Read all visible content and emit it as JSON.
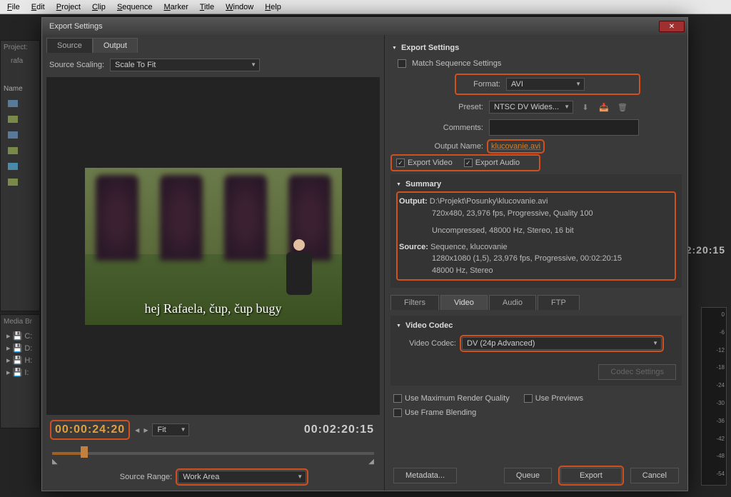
{
  "menubar": [
    "File",
    "Edit",
    "Project",
    "Clip",
    "Sequence",
    "Marker",
    "Title",
    "Window",
    "Help"
  ],
  "bg": {
    "project_label": "Project:",
    "item_label": "rafa",
    "name_col": "Name",
    "mediab": "Media Br",
    "drives": [
      "C:",
      "D:",
      "H:",
      "I:"
    ],
    "side_tc": "2:20:15"
  },
  "dialog": {
    "title": "Export Settings",
    "tabs": {
      "source": "Source",
      "output": "Output"
    },
    "source_scaling_label": "Source Scaling:",
    "source_scaling_value": "Scale To Fit",
    "preview_caption": "hej Rafaela, čup, čup bugy",
    "tc_in": "00:00:24:20",
    "tc_out": "00:02:20:15",
    "fit_label": "Fit",
    "source_range_label": "Source Range:",
    "source_range_value": "Work Area"
  },
  "export": {
    "header": "Export Settings",
    "match_seq": "Match Sequence Settings",
    "format_label": "Format:",
    "format_value": "AVI",
    "preset_label": "Preset:",
    "preset_value": "NTSC DV Wides...",
    "comments_label": "Comments:",
    "output_name_label": "Output Name:",
    "output_name_value": "klucovanie.avi",
    "export_video": "Export Video",
    "export_audio": "Export Audio"
  },
  "summary": {
    "header": "Summary",
    "output_label": "Output:",
    "output_path": "D:\\Projekt\\Posunky\\klucovanie.avi",
    "output_spec": "720x480, 23,976 fps, Progressive, Quality 100",
    "output_audio": "Uncompressed, 48000 Hz, Stereo, 16 bit",
    "source_label": "Source:",
    "source_seq": "Sequence, klucovanie",
    "source_spec": "1280x1080 (1,5), 23,976 fps, Progressive, 00:02:20:15",
    "source_audio": "48000 Hz, Stereo"
  },
  "subtabs": {
    "filters": "Filters",
    "video": "Video",
    "audio": "Audio",
    "ftp": "FTP"
  },
  "codec": {
    "header": "Video Codec",
    "label": "Video Codec:",
    "value": "DV (24p Advanced)",
    "settings_btn": "Codec Settings"
  },
  "checks": {
    "max_quality": "Use Maximum Render Quality",
    "use_previews": "Use Previews",
    "frame_blend": "Use Frame Blending"
  },
  "buttons": {
    "metadata": "Metadata...",
    "queue": "Queue",
    "export": "Export",
    "cancel": "Cancel"
  },
  "meter_ticks": [
    "0",
    "-6",
    "-12",
    "-18",
    "-24",
    "-30",
    "-36",
    "-42",
    "-48",
    "-54"
  ]
}
